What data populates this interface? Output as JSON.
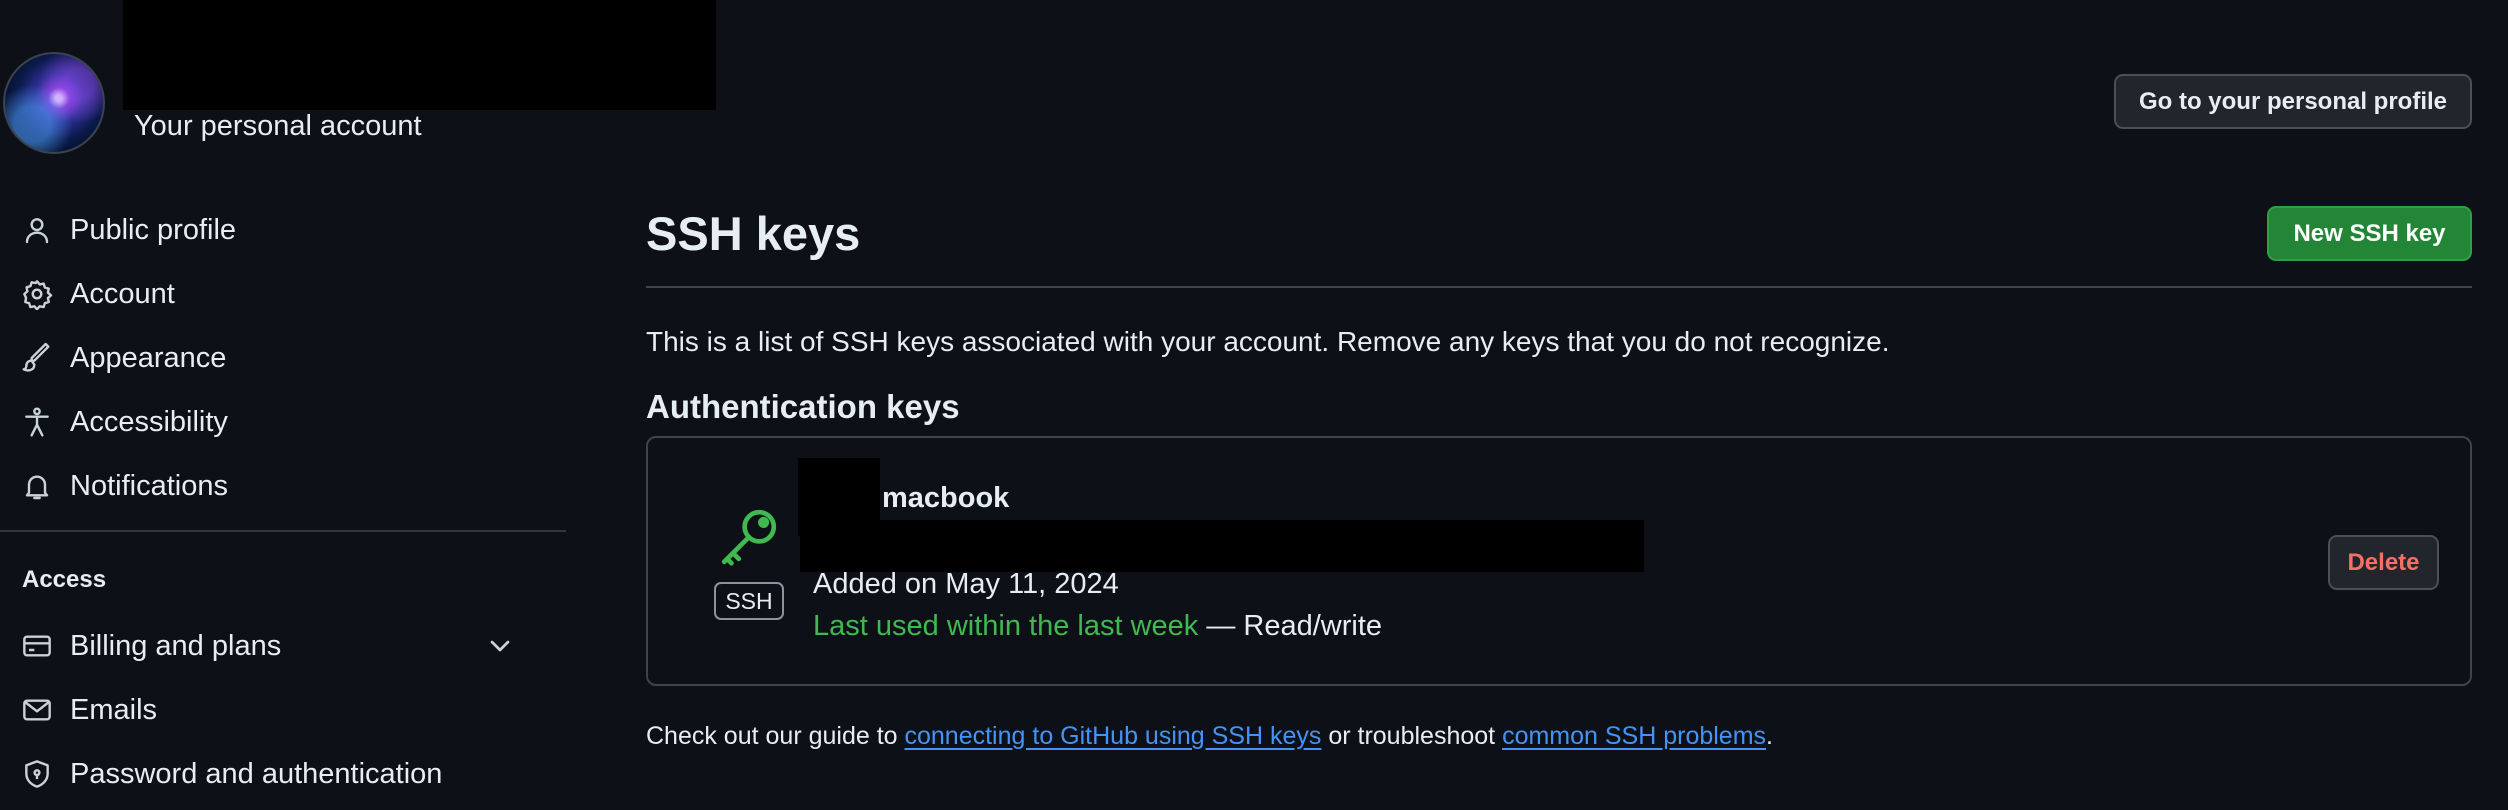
{
  "header": {
    "account_subtitle": "Your personal account",
    "profile_button": "Go to your personal profile"
  },
  "sidebar": {
    "items": [
      {
        "label": "Public profile",
        "icon": "person-icon"
      },
      {
        "label": "Account",
        "icon": "gear-icon"
      },
      {
        "label": "Appearance",
        "icon": "paintbrush-icon"
      },
      {
        "label": "Accessibility",
        "icon": "accessibility-icon"
      },
      {
        "label": "Notifications",
        "icon": "bell-icon"
      }
    ],
    "access_heading": "Access",
    "access_items": [
      {
        "label": "Billing and plans",
        "icon": "credit-card-icon",
        "expandable": true
      },
      {
        "label": "Emails",
        "icon": "mail-icon"
      },
      {
        "label": "Password and authentication",
        "icon": "shield-lock-icon"
      }
    ]
  },
  "main": {
    "title": "SSH keys",
    "new_key_button": "New SSH key",
    "intro": "This is a list of SSH keys associated with your account. Remove any keys that you do not recognize.",
    "auth_heading": "Authentication keys",
    "key": {
      "title_suffix": "macbook",
      "type_badge": "SSH",
      "added": "Added on May 11, 2024",
      "last_used": "Last used within the last week",
      "access": " — Read/write",
      "delete_button": "Delete"
    },
    "guide": {
      "prefix": "Check out our guide to ",
      "link1": "connecting to GitHub using SSH keys",
      "middle": " or troubleshoot ",
      "link2": "common SSH problems",
      "suffix": "."
    }
  },
  "colors": {
    "background": "#0d1117",
    "accent_green": "#238636",
    "success_text": "#3fb950",
    "danger_text": "#f47067",
    "link": "#4493f8"
  }
}
